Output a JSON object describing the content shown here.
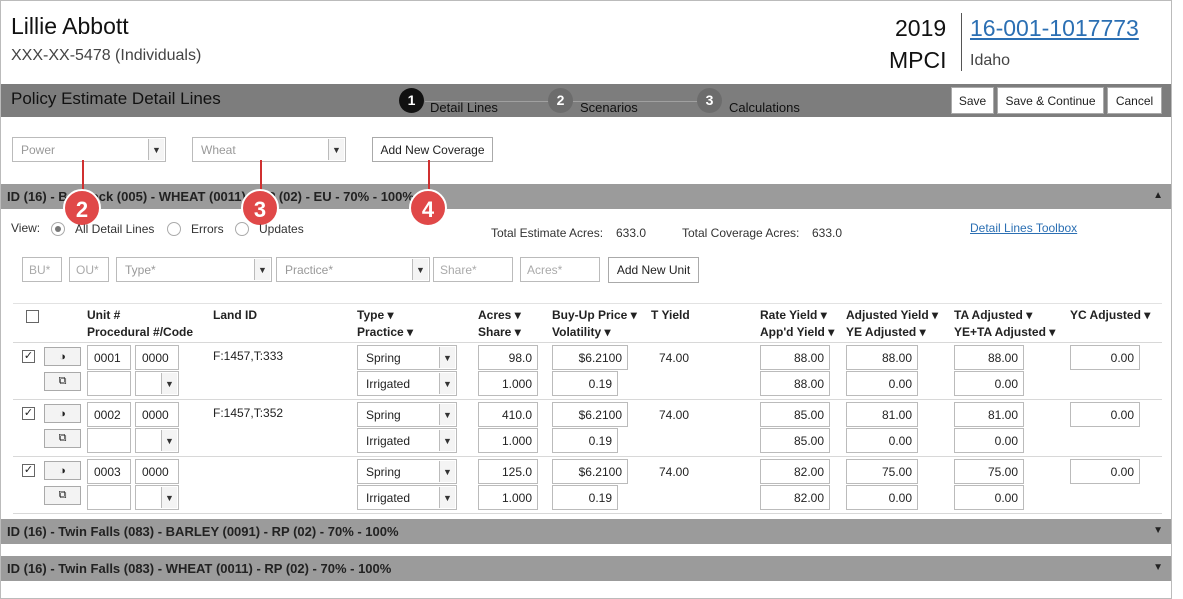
{
  "header": {
    "client_name": "Lillie Abbott",
    "client_ssn": "XXX-XX-5478 (Individuals)",
    "year": "2019",
    "program": "MPCI",
    "policy_number": "16-001-1017773",
    "state": "Idaho"
  },
  "titlebar": {
    "title": "Policy Estimate Detail Lines",
    "steps": [
      {
        "num": "1",
        "label": "Detail Lines"
      },
      {
        "num": "2",
        "label": "Scenarios"
      },
      {
        "num": "3",
        "label": "Calculations"
      }
    ],
    "save": "Save",
    "save_continue": "Save & Continue",
    "cancel": "Cancel"
  },
  "filters": {
    "county_value": "Power",
    "crop_value": "Wheat",
    "add_coverage": "Add New Coverage"
  },
  "badges": [
    "2",
    "3",
    "4"
  ],
  "coverages": [
    {
      "label": "ID (16) - Bannock (005) - WHEAT (0011) - RP (02) - EU - 70% - 100%",
      "expanded": true
    },
    {
      "label": "ID (16) - Twin Falls (083) - BARLEY (0091) - RP (02) - 70% - 100%",
      "expanded": false
    },
    {
      "label": "ID (16) - Twin Falls (083) - WHEAT (0011) - RP (02) - 70% - 100%",
      "expanded": false
    }
  ],
  "view": {
    "label": "View:",
    "options": [
      "All Detail Lines",
      "Errors",
      "Updates"
    ],
    "total_estimate_label": "Total Estimate Acres:",
    "total_estimate_value": "633.0",
    "total_coverage_label": "Total Coverage Acres:",
    "total_coverage_value": "633.0",
    "toolbox": "Detail Lines Toolbox"
  },
  "new_unit": {
    "bu_placeholder": "BU*",
    "ou_placeholder": "OU*",
    "type_placeholder": "Type*",
    "practice_placeholder": "Practice*",
    "share_placeholder": "Share*",
    "acres_placeholder": "Acres*",
    "add_unit": "Add New Unit"
  },
  "columns": {
    "unit": "Unit #",
    "procedural": "Procedural #/Code",
    "land_id": "Land ID",
    "type": "Type",
    "practice": "Practice",
    "acres": "Acres",
    "share": "Share",
    "buyup": "Buy-Up Price",
    "volatility": "Volatility",
    "tyield": "T Yield",
    "rate_yield": "Rate Yield",
    "appd_yield": "App'd Yield",
    "adj_yield": "Adjusted Yield",
    "ye_adj": "YE Adjusted",
    "ta_adj": "TA Adjusted",
    "yeta_adj": "YE+TA Adjusted",
    "yc_adj": "YC Adjusted"
  },
  "rows": [
    {
      "unit": "0001",
      "sub": "0000",
      "land_id": "F:1457,T:333",
      "type": "Spring",
      "practice": "Irrigated",
      "acres": "98.0",
      "share": "1.000",
      "buyup": "$6.2100",
      "volatility": "0.19",
      "tyield": "74.00",
      "rate_yield": "88.00",
      "appd_yield": "88.00",
      "adj_yield": "88.00",
      "ye_adj": "0.00",
      "ta_adj": "88.00",
      "yeta_adj": "0.00",
      "yc_adj": "0.00"
    },
    {
      "unit": "0002",
      "sub": "0000",
      "land_id": "F:1457,T:352",
      "type": "Spring",
      "practice": "Irrigated",
      "acres": "410.0",
      "share": "1.000",
      "buyup": "$6.2100",
      "volatility": "0.19",
      "tyield": "74.00",
      "rate_yield": "85.00",
      "appd_yield": "85.00",
      "adj_yield": "81.00",
      "ye_adj": "0.00",
      "ta_adj": "81.00",
      "yeta_adj": "0.00",
      "yc_adj": "0.00"
    },
    {
      "unit": "0003",
      "sub": "0000",
      "land_id": "",
      "type": "Spring",
      "practice": "Irrigated",
      "acres": "125.0",
      "share": "1.000",
      "buyup": "$6.2100",
      "volatility": "0.19",
      "tyield": "74.00",
      "rate_yield": "82.00",
      "appd_yield": "82.00",
      "adj_yield": "75.00",
      "ye_adj": "0.00",
      "ta_adj": "75.00",
      "yeta_adj": "0.00",
      "yc_adj": "0.00"
    }
  ]
}
